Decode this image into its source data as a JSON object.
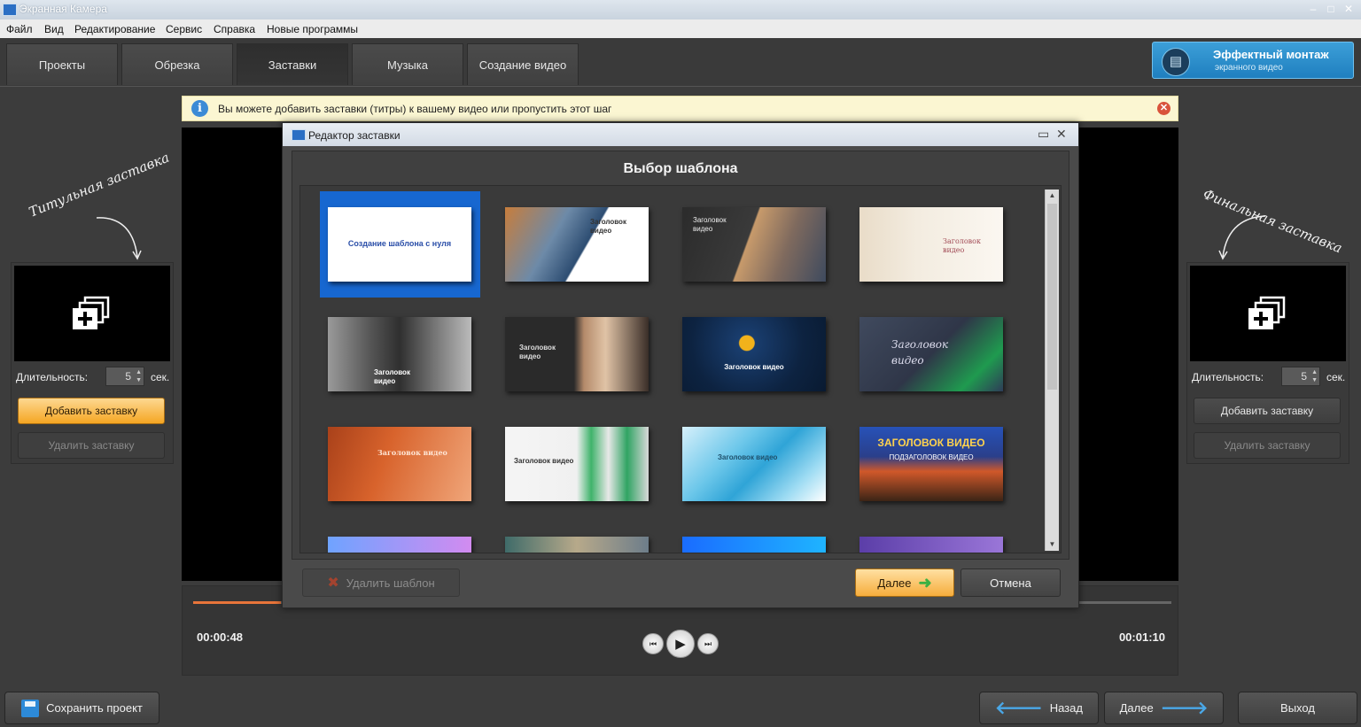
{
  "window": {
    "title": "Экранная Камера"
  },
  "menu": [
    "Файл",
    "Вид",
    "Редактирование",
    "Сервис",
    "Справка",
    "Новые программы"
  ],
  "tabs": [
    {
      "label": "Проекты",
      "active": false
    },
    {
      "label": "Обрезка",
      "active": false
    },
    {
      "label": "Заставки",
      "active": true
    },
    {
      "label": "Музыка",
      "active": false
    },
    {
      "label": "Создание видео",
      "active": false
    }
  ],
  "promo": {
    "line1": "Эффектный монтаж",
    "line2": "экранного видео",
    "icon": "clapperboard-icon"
  },
  "info": {
    "text": "Вы можете добавить заставки (титры) к вашему видео или пропустить этот шаг",
    "icon": "info-icon"
  },
  "left_panel": {
    "caption": "Титульная заставка",
    "duration_label": "Длительность:",
    "duration_value": "5",
    "unit": "сек.",
    "add_button": "Добавить заставку",
    "remove_button": "Удалить заставку"
  },
  "right_panel": {
    "caption": "Финальная заставка",
    "duration_label": "Длительность:",
    "duration_value": "5",
    "unit": "сек.",
    "add_button": "Добавить заставку",
    "remove_button": "Удалить заставку"
  },
  "player": {
    "current_time": "00:00:48",
    "total_time": "00:01:10",
    "progress": 0.09
  },
  "dialog": {
    "title": "Редактор заставки",
    "heading": "Выбор шаблона",
    "delete_template": "Удалить шаблон",
    "next": "Далее",
    "cancel": "Отмена",
    "templates": [
      {
        "text": "Создание шаблона с нуля",
        "selected": true
      },
      {
        "text": "Заголовок видео"
      },
      {
        "text": "Заголовок видео"
      },
      {
        "text": "Заголовок видео"
      },
      {
        "text": "Заголовок видео"
      },
      {
        "text": "Заголовок видео"
      },
      {
        "text": "Заголовок видео"
      },
      {
        "text": "Заголовок видео"
      },
      {
        "text": "Заголовок видео"
      },
      {
        "text": "Заголовок видео"
      },
      {
        "text": "Заголовок видео"
      },
      {
        "text": "ЗАГОЛОВОК ВИДЕО",
        "sub": "ПОДЗАГОЛОВОК ВИДЕО"
      }
    ]
  },
  "bottom": {
    "save": "Сохранить проект",
    "back": "Назад",
    "next": "Далее",
    "exit": "Выход"
  }
}
